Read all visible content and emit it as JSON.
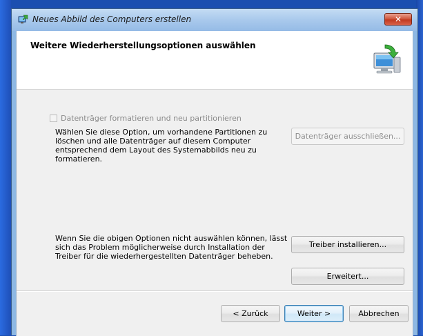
{
  "window": {
    "title": "Neues Abbild des Computers erstellen",
    "close_glyph": "✕"
  },
  "header": {
    "title": "Weitere Wiederherstellungsoptionen auswählen"
  },
  "format_option": {
    "checkbox_label": "Datenträger formatieren und neu partitionieren",
    "checked": false,
    "enabled": false,
    "description": "Wählen Sie diese Option, um vorhandene Partitionen zu löschen und alle Datenträger auf diesem Computer entsprechend dem Layout des Systemabbilds neu zu formatieren.",
    "exclude_button_label": "Datenträger ausschließen..."
  },
  "drivers": {
    "description": "Wenn Sie die obigen Optionen nicht auswählen können, lässt sich das Problem möglicherweise durch Installation der Treiber für die wiederhergestellten Datenträger beheben.",
    "install_button_label": "Treiber installieren...",
    "advanced_button_label": "Erweitert..."
  },
  "footer": {
    "back_label": "< Zurück",
    "next_label": "Weiter >",
    "cancel_label": "Abbrechen"
  },
  "icons": {
    "title_icon": "restore-computer-icon",
    "header_icon": "computer-restore-icon"
  },
  "colors": {
    "desktop": "#1b4fb0",
    "title_bar": "#a9c9ec",
    "close_button": "#c13a20",
    "client_bg": "#f0f0f0",
    "header_bg": "#ffffff",
    "default_button_border": "#3c7fb1"
  }
}
